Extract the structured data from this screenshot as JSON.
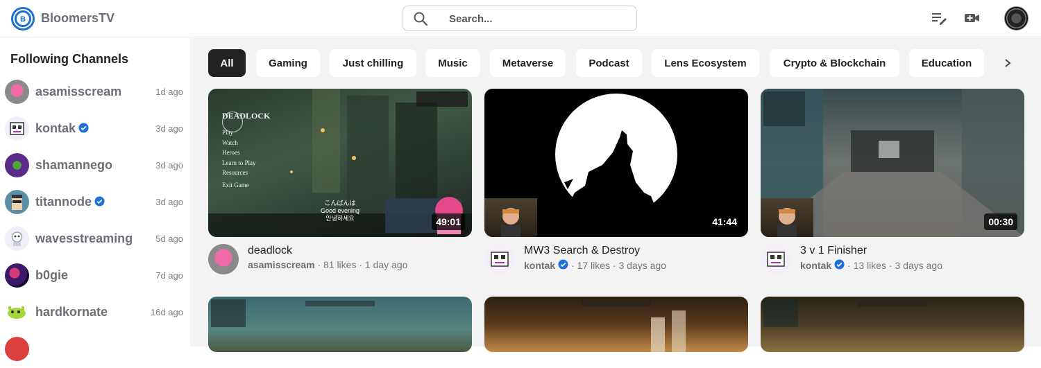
{
  "header": {
    "brand": "BloomersTV",
    "search_placeholder": "Search...",
    "icons": [
      "playlist-add-icon",
      "video-camera-icon"
    ]
  },
  "sidebar": {
    "title": "Following Channels",
    "channels": [
      {
        "name": "asamisscream",
        "time": "1d ago",
        "verified": false
      },
      {
        "name": "kontak",
        "time": "3d ago",
        "verified": true
      },
      {
        "name": "shamannego",
        "time": "3d ago",
        "verified": false
      },
      {
        "name": "titannode",
        "time": "3d ago",
        "verified": true
      },
      {
        "name": "wavesstreaming",
        "time": "5d ago",
        "verified": false
      },
      {
        "name": "b0gie",
        "time": "7d ago",
        "verified": false
      },
      {
        "name": "hardkornate",
        "time": "16d ago",
        "verified": false
      }
    ]
  },
  "categories": [
    "All",
    "Gaming",
    "Just chilling",
    "Music",
    "Metaverse",
    "Podcast",
    "Lens Ecosystem",
    "Crypto & Blockchain",
    "Education"
  ],
  "active_category": "All",
  "videos": [
    {
      "title": "deadlock",
      "channel": "asamisscream",
      "verified": false,
      "likes": "81 likes",
      "age": "1 day ago",
      "duration": "49:01"
    },
    {
      "title": "MW3 Search & Destroy",
      "channel": "kontak",
      "verified": true,
      "likes": "17 likes",
      "age": "3 days ago",
      "duration": "41:44"
    },
    {
      "title": "3 v 1 Finisher",
      "channel": "kontak",
      "verified": true,
      "likes": "13 likes",
      "age": "3 days ago",
      "duration": "00:30"
    }
  ],
  "deadlock_thumb": {
    "logo": "DEADLOCK",
    "menu": [
      "Play",
      "Watch",
      "Heroes",
      "Learn to Play",
      "Resources",
      "Exit Game"
    ],
    "subtitles": [
      "こんばんは",
      "Good evening",
      "안녕하세요"
    ]
  },
  "colors": {
    "accent": "#1f6fd1",
    "verified": "#1d72d8",
    "active_chip": "#222222"
  }
}
